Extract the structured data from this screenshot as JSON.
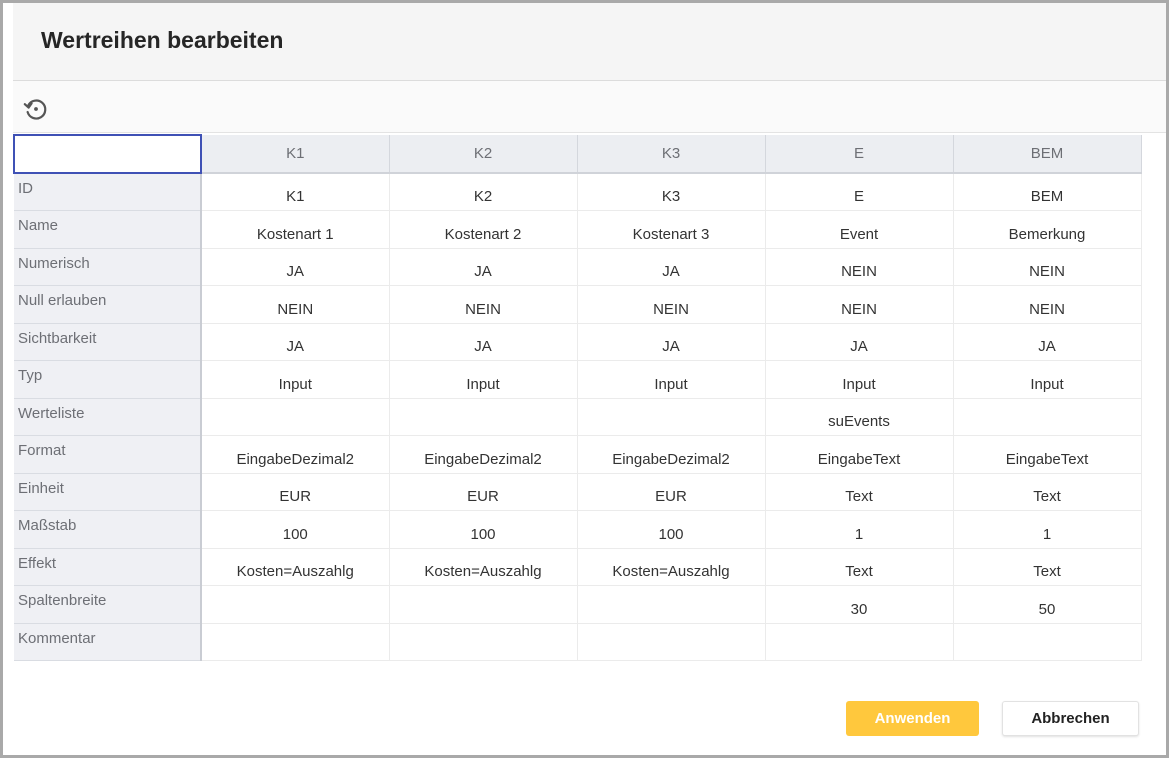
{
  "dialog": {
    "title": "Wertreihen bearbeiten"
  },
  "toolbar": {
    "reset_icon": "history-reset-icon"
  },
  "grid": {
    "corner_value": "",
    "columns": [
      "K1",
      "K2",
      "K3",
      "E",
      "BEM"
    ],
    "rows": [
      {
        "label": "ID",
        "cells": [
          "K1",
          "K2",
          "K3",
          "E",
          "BEM"
        ]
      },
      {
        "label": "Name",
        "cells": [
          "Kostenart 1",
          "Kostenart 2",
          "Kostenart 3",
          "Event",
          "Bemerkung"
        ]
      },
      {
        "label": "Numerisch",
        "cells": [
          "JA",
          "JA",
          "JA",
          "NEIN",
          "NEIN"
        ]
      },
      {
        "label": "Null erlauben",
        "cells": [
          "NEIN",
          "NEIN",
          "NEIN",
          "NEIN",
          "NEIN"
        ]
      },
      {
        "label": "Sichtbarkeit",
        "cells": [
          "JA",
          "JA",
          "JA",
          "JA",
          "JA"
        ]
      },
      {
        "label": "Typ",
        "cells": [
          "Input",
          "Input",
          "Input",
          "Input",
          "Input"
        ]
      },
      {
        "label": "Werteliste",
        "cells": [
          "",
          "",
          "",
          "suEvents",
          ""
        ]
      },
      {
        "label": "Format",
        "cells": [
          "EingabeDezimal2",
          "EingabeDezimal2",
          "EingabeDezimal2",
          "EingabeText",
          "EingabeText"
        ]
      },
      {
        "label": "Einheit",
        "cells": [
          "EUR",
          "EUR",
          "EUR",
          "Text",
          "Text"
        ]
      },
      {
        "label": "Maßstab",
        "cells": [
          "100",
          "100",
          "100",
          "1",
          "1"
        ]
      },
      {
        "label": "Effekt",
        "cells": [
          "Kosten=Auszahlg",
          "Kosten=Auszahlg",
          "Kosten=Auszahlg",
          "Text",
          "Text"
        ]
      },
      {
        "label": "Spaltenbreite",
        "cells": [
          "",
          "",
          "",
          "30",
          "50"
        ]
      },
      {
        "label": "Kommentar",
        "cells": [
          "",
          "",
          "",
          "",
          ""
        ]
      }
    ]
  },
  "footer": {
    "apply_label": "Anwenden",
    "cancel_label": "Abbrechen"
  },
  "colors": {
    "apply_bg": "#ffc83d",
    "selection_border": "#3f51b5",
    "header_bg": "#eceef2"
  }
}
